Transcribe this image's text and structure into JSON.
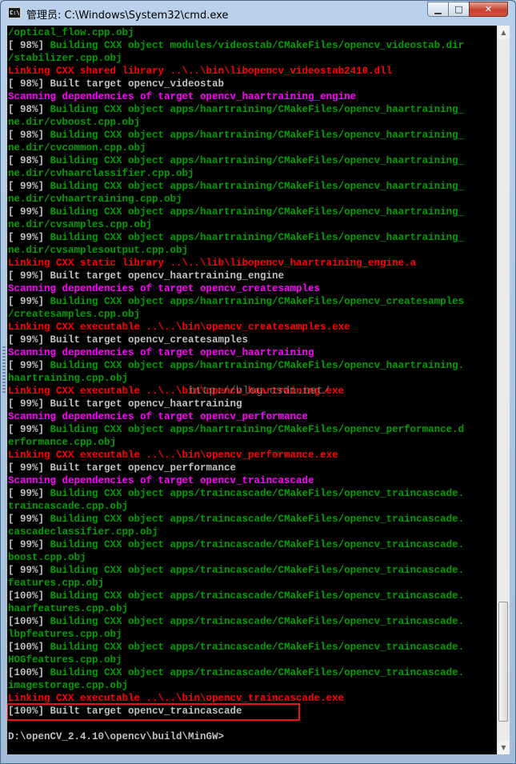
{
  "window": {
    "title": "管理员: C:\\Windows\\System32\\cmd.exe",
    "icon_name": "cmd-app-icon",
    "icon_text": "C:\\",
    "controls": {
      "minimize": "▁",
      "maximize": "□",
      "close": "✕"
    }
  },
  "console": {
    "watermark": "http://blog.csdn.net/",
    "lines": [
      {
        "text": "/optical_flow.cpp.obj",
        "color": "green"
      },
      {
        "segments": [
          {
            "text": "[ 98%] ",
            "color": "white"
          },
          {
            "text": "Building CXX object modules/videostab/CMakeFiles/opencv_videostab.dir",
            "color": "green"
          }
        ]
      },
      {
        "text": "/stabilizer.cpp.obj",
        "color": "green"
      },
      {
        "text": "Linking CXX shared library ..\\..\\bin\\libopencv_videostab2410.dll",
        "color": "red"
      },
      {
        "text": "[ 98%] Built target opencv_videostab",
        "color": "white"
      },
      {
        "text": "Scanning dependencies of target opencv_haartraining_engine",
        "color": "magenta"
      },
      {
        "segments": [
          {
            "text": "[ 98%] ",
            "color": "white"
          },
          {
            "text": "Building CXX object apps/haartraining/CMakeFiles/opencv_haartraining_",
            "color": "green"
          }
        ]
      },
      {
        "text": "ne.dir/cvboost.cpp.obj",
        "color": "green"
      },
      {
        "segments": [
          {
            "text": "[ 98%] ",
            "color": "white"
          },
          {
            "text": "Building CXX object apps/haartraining/CMakeFiles/opencv_haartraining_",
            "color": "green"
          }
        ]
      },
      {
        "text": "ne.dir/cvcommon.cpp.obj",
        "color": "green"
      },
      {
        "segments": [
          {
            "text": "[ 98%] ",
            "color": "white"
          },
          {
            "text": "Building CXX object apps/haartraining/CMakeFiles/opencv_haartraining_",
            "color": "green"
          }
        ]
      },
      {
        "text": "ne.dir/cvhaarclassifier.cpp.obj",
        "color": "green"
      },
      {
        "segments": [
          {
            "text": "[ 99%] ",
            "color": "white"
          },
          {
            "text": "Building CXX object apps/haartraining/CMakeFiles/opencv_haartraining_",
            "color": "green"
          }
        ]
      },
      {
        "text": "ne.dir/cvhaartraining.cpp.obj",
        "color": "green"
      },
      {
        "segments": [
          {
            "text": "[ 99%] ",
            "color": "white"
          },
          {
            "text": "Building CXX object apps/haartraining/CMakeFiles/opencv_haartraining_",
            "color": "green"
          }
        ]
      },
      {
        "text": "ne.dir/cvsamples.cpp.obj",
        "color": "green"
      },
      {
        "segments": [
          {
            "text": "[ 99%] ",
            "color": "white"
          },
          {
            "text": "Building CXX object apps/haartraining/CMakeFiles/opencv_haartraining_",
            "color": "green"
          }
        ]
      },
      {
        "text": "ne.dir/cvsamplesoutput.cpp.obj",
        "color": "green"
      },
      {
        "text": "Linking CXX static library ..\\..\\lib\\libopencv_haartraining_engine.a",
        "color": "red"
      },
      {
        "text": "[ 99%] Built target opencv_haartraining_engine",
        "color": "white"
      },
      {
        "text": "Scanning dependencies of target opencv_createsamples",
        "color": "magenta"
      },
      {
        "segments": [
          {
            "text": "[ 99%] ",
            "color": "white"
          },
          {
            "text": "Building CXX object apps/haartraining/CMakeFiles/opencv_createsamples",
            "color": "green"
          }
        ]
      },
      {
        "text": "/createsamples.cpp.obj",
        "color": "green"
      },
      {
        "text": "Linking CXX executable ..\\..\\bin\\opencv_createsamples.exe",
        "color": "red"
      },
      {
        "text": "[ 99%] Built target opencv_createsamples",
        "color": "white"
      },
      {
        "text": "Scanning dependencies of target opencv_haartraining",
        "color": "magenta"
      },
      {
        "segments": [
          {
            "text": "[ 99%] ",
            "color": "white"
          },
          {
            "text": "Building CXX object apps/haartraining/CMakeFiles/opencv_haartraining.",
            "color": "green"
          }
        ]
      },
      {
        "text": "haartraining.cpp.obj",
        "color": "green"
      },
      {
        "text": "Linking CXX executable ..\\..\\bin\\opencv_haartraining.exe",
        "color": "red"
      },
      {
        "text": "[ 99%] Built target opencv_haartraining",
        "color": "white"
      },
      {
        "text": "Scanning dependencies of target opencv_performance",
        "color": "magenta"
      },
      {
        "segments": [
          {
            "text": "[ 99%] ",
            "color": "white"
          },
          {
            "text": "Building CXX object apps/haartraining/CMakeFiles/opencv_performance.d",
            "color": "green"
          }
        ]
      },
      {
        "text": "erformance.cpp.obj",
        "color": "green"
      },
      {
        "text": "Linking CXX executable ..\\..\\bin\\opencv_performance.exe",
        "color": "red"
      },
      {
        "text": "[ 99%] Built target opencv_performance",
        "color": "white"
      },
      {
        "text": "Scanning dependencies of target opencv_traincascade",
        "color": "magenta"
      },
      {
        "segments": [
          {
            "text": "[ 99%] ",
            "color": "white"
          },
          {
            "text": "Building CXX object apps/traincascade/CMakeFiles/opencv_traincascade.",
            "color": "green"
          }
        ]
      },
      {
        "text": "traincascade.cpp.obj",
        "color": "green"
      },
      {
        "segments": [
          {
            "text": "[ 99%] ",
            "color": "white"
          },
          {
            "text": "Building CXX object apps/traincascade/CMakeFiles/opencv_traincascade.",
            "color": "green"
          }
        ]
      },
      {
        "text": "cascadeclassifier.cpp.obj",
        "color": "green"
      },
      {
        "segments": [
          {
            "text": "[ 99%] ",
            "color": "white"
          },
          {
            "text": "Building CXX object apps/traincascade/CMakeFiles/opencv_traincascade.",
            "color": "green"
          }
        ]
      },
      {
        "text": "boost.cpp.obj",
        "color": "green"
      },
      {
        "segments": [
          {
            "text": "[ 99%] ",
            "color": "white"
          },
          {
            "text": "Building CXX object apps/traincascade/CMakeFiles/opencv_traincascade.",
            "color": "green"
          }
        ]
      },
      {
        "text": "features.cpp.obj",
        "color": "green"
      },
      {
        "segments": [
          {
            "text": "[100%] ",
            "color": "white"
          },
          {
            "text": "Building CXX object apps/traincascade/CMakeFiles/opencv_traincascade.",
            "color": "green"
          }
        ]
      },
      {
        "text": "haarfeatures.cpp.obj",
        "color": "green"
      },
      {
        "segments": [
          {
            "text": "[100%] ",
            "color": "white"
          },
          {
            "text": "Building CXX object apps/traincascade/CMakeFiles/opencv_traincascade.",
            "color": "green"
          }
        ]
      },
      {
        "text": "lbpfeatures.cpp.obj",
        "color": "green"
      },
      {
        "segments": [
          {
            "text": "[100%] ",
            "color": "white"
          },
          {
            "text": "Building CXX object apps/traincascade/CMakeFiles/opencv_traincascade.",
            "color": "green"
          }
        ]
      },
      {
        "text": "HOGfeatures.cpp.obj",
        "color": "green"
      },
      {
        "segments": [
          {
            "text": "[100%] ",
            "color": "white"
          },
          {
            "text": "Building CXX object apps/traincascade/CMakeFiles/opencv_traincascade.",
            "color": "green"
          }
        ]
      },
      {
        "text": "imagestorage.cpp.obj",
        "color": "green"
      },
      {
        "text": "Linking CXX executable ..\\..\\bin\\opencv_traincascade.exe",
        "color": "red"
      },
      {
        "text": "[100%] Built target opencv_traincascade",
        "color": "white",
        "highlighted": true
      },
      {
        "text": "",
        "color": "white"
      },
      {
        "text": "D:\\openCV_2.4.10\\opencv\\build\\MinGW>",
        "color": "white"
      }
    ]
  },
  "colors": {
    "white": "#c0c0c0",
    "green": "#00a000",
    "red": "#ff0000",
    "magenta": "#ff00ff",
    "highlight_box": "#e11111"
  }
}
